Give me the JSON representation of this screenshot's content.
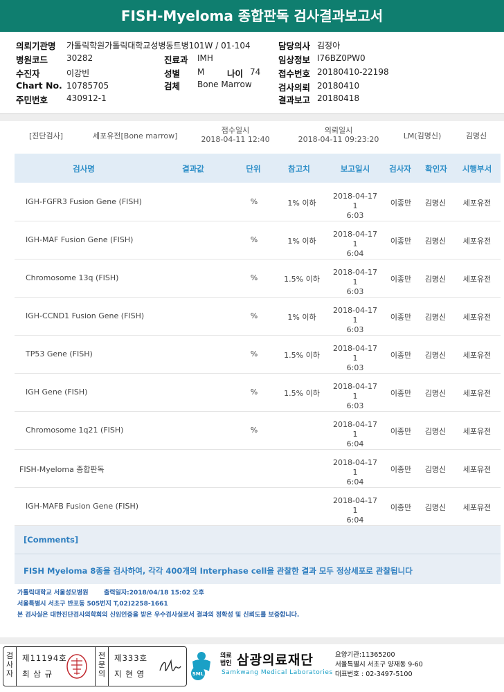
{
  "title": "FISH-Myeloma 종합판독 검사결과보고서",
  "patient": {
    "institution_label": "의뢰기관명",
    "institution": "가톨릭학원가톨릭대학교성병동트병101W / 01-104",
    "hospital_code_label": "병원코드",
    "hospital_code": "30282",
    "patient_label": "수진자",
    "patient": "이강빈",
    "chart_label": "Chart No.",
    "chart_no": "10785705",
    "id_label": "주민번호",
    "id_no": "430912-1",
    "dept_label": "진료과",
    "dept": "IMH",
    "sex_label": "성별",
    "sex": "M",
    "age_label": "나이",
    "age": "74",
    "specimen_label": "검체",
    "specimen": "Bone Marrow",
    "doctor_label": "담당의사",
    "doctor": "김정아",
    "clinical_label": "임상정보",
    "clinical": "I76BZ0PW0",
    "receipt_label": "접수번호",
    "receipt": "20180410-22198",
    "request_label": "검사의뢰",
    "request": "20180410",
    "report_label": "결과보고",
    "report": "20180418"
  },
  "request_row": {
    "category": "[진단검사]",
    "test": "세포유전[Bone marrow]",
    "receipt_label": "접수일시",
    "receipt_time": "2018-04-11 12:40",
    "request_label": "의뢰일시",
    "request_time": "2018-04-11 09:23:20",
    "lm": "LM(김명신)",
    "person": "김명신"
  },
  "table_headers": [
    "검사명",
    "결과값",
    "단위",
    "참고치",
    "보고일시",
    "검사자",
    "확인자",
    "시행부서"
  ],
  "rows": [
    {
      "name": "IGH-FGFR3 Fusion Gene (FISH)",
      "unit": "%",
      "ref": "1% 이하",
      "date1": "2018-04-17 1",
      "date2": "6:03",
      "tester": "이종만",
      "confirm": "김명신",
      "dept": "세포유전"
    },
    {
      "name": "IGH-MAF Fusion Gene (FISH)",
      "unit": "%",
      "ref": "1% 이하",
      "date1": "2018-04-17 1",
      "date2": "6:04",
      "tester": "이종만",
      "confirm": "김명신",
      "dept": "세포유전"
    },
    {
      "name": "Chromosome 13q (FISH)",
      "unit": "%",
      "ref": "1.5% 이하",
      "date1": "2018-04-17 1",
      "date2": "6:03",
      "tester": "이종만",
      "confirm": "김명신",
      "dept": "세포유전"
    },
    {
      "name": "IGH-CCND1 Fusion Gene (FISH)",
      "unit": "%",
      "ref": "1% 이하",
      "date1": "2018-04-17 1",
      "date2": "6:03",
      "tester": "이종만",
      "confirm": "김명신",
      "dept": "세포유전"
    },
    {
      "name": "TP53 Gene (FISH)",
      "unit": "%",
      "ref": "1.5% 이하",
      "date1": "2018-04-17 1",
      "date2": "6:03",
      "tester": "이종만",
      "confirm": "김명신",
      "dept": "세포유전"
    },
    {
      "name": "IGH Gene (FISH)",
      "unit": "%",
      "ref": "1.5% 이하",
      "date1": "2018-04-17 1",
      "date2": "6:03",
      "tester": "이종만",
      "confirm": "김명신",
      "dept": "세포유전"
    },
    {
      "name": "Chromosome 1q21 (FISH)",
      "unit": "%",
      "ref": "",
      "date1": "2018-04-17 1",
      "date2": "6:04",
      "tester": "이종만",
      "confirm": "김명신",
      "dept": "세포유전"
    },
    {
      "name": "FISH-Myeloma 종합판독",
      "unit": "",
      "ref": "",
      "date1": "2018-04-17 1",
      "date2": "6:04",
      "tester": "이종만",
      "confirm": "김명신",
      "dept": "세포유전"
    },
    {
      "name": "IGH-MAFB Fusion Gene (FISH)",
      "unit": "",
      "ref": "",
      "date1": "2018-04-17 1",
      "date2": "6:04",
      "tester": "이종만",
      "confirm": "김명신",
      "dept": "세포유전"
    }
  ],
  "comments": {
    "header": "[Comments]",
    "text": "FISH Myeloma 8종을 검사하여, 각각 400개의 Interphase cell을 관찰한 결과 모두 정상세포로 관찰됩니다"
  },
  "footer": {
    "hospital": "가톨릭대학교 서울성모병원",
    "printed": "출력일자:2018/04/18 15:02 오후",
    "address": "서울특별시 서초구 반포동 505번지 T,02)2258-1661",
    "notice": "본 검사실은 대한진단검사의학회의 신임인증을 받은 우수검사실로서 결과의 정확성 및 신뢰도를 보증합니다."
  },
  "signature": {
    "tester_label": "검사자",
    "tester_no": "제11194호",
    "tester_name": "최 삼 규",
    "doctor_label": "전문의",
    "doctor_no": "제333호",
    "doctor_name": "지 현 영"
  },
  "lab": {
    "corp_small": "의료법인",
    "name": "삼광의료재단",
    "english": "Samkwang Medical Laboratories",
    "logo_text": "SML",
    "code": "요양기관:11365200",
    "address": "서울특별시 서초구 양재동 9-60",
    "phone": "대표번호 : 02-3497-5100"
  }
}
